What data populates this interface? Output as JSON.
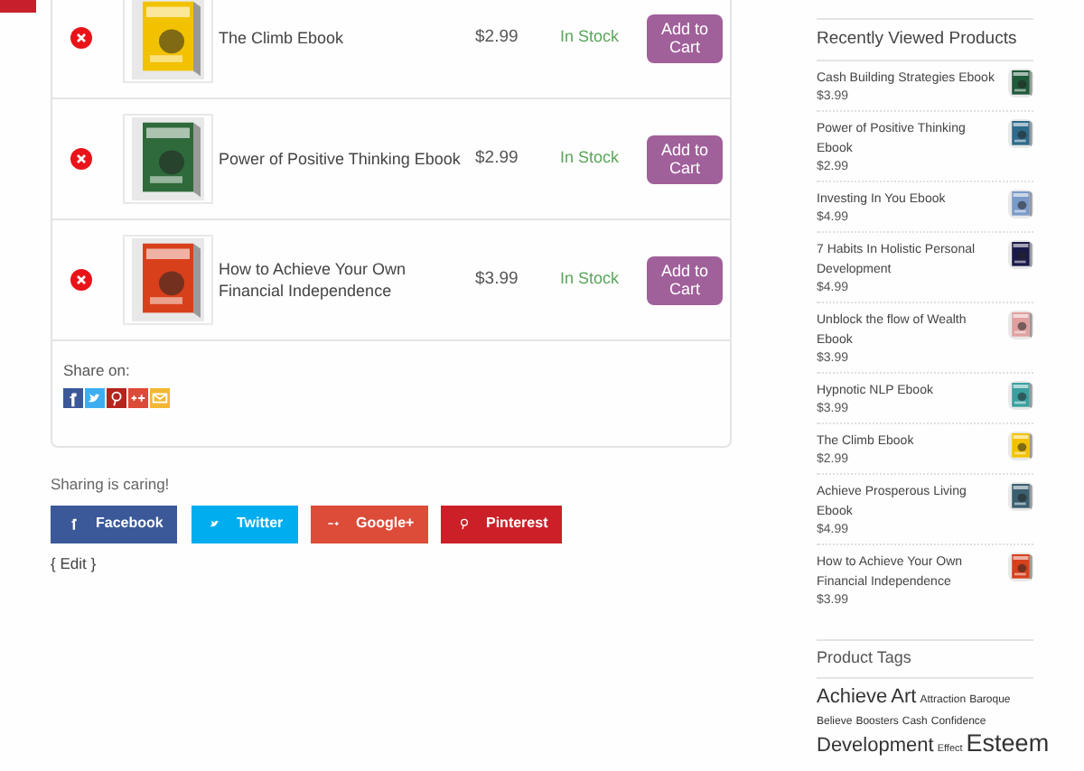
{
  "wishlist": {
    "rows": [
      {
        "name": "The Climb Ebook",
        "price": "$2.99",
        "stock": "In Stock",
        "button": "Add to Cart",
        "color": "#f2c200"
      },
      {
        "name": "Power of Positive Thinking Ebook",
        "price": "$2.99",
        "stock": "In Stock",
        "button": "Add to Cart",
        "color": "#2e6a3a"
      },
      {
        "name": "How to Achieve Your Own Financial Independence",
        "price": "$3.99",
        "stock": "In Stock",
        "button": "Add to Cart",
        "color": "#d8401c"
      }
    ],
    "share": {
      "label": "Share on:",
      "icons": [
        {
          "kind": "facebook"
        },
        {
          "kind": "twitter"
        },
        {
          "kind": "pinterest"
        },
        {
          "kind": "googleplus"
        },
        {
          "kind": "email"
        }
      ]
    }
  },
  "sharing": {
    "label": "Sharing is caring!",
    "buttons": [
      {
        "kind": "facebook",
        "label": "Facebook"
      },
      {
        "kind": "twitter",
        "label": "Twitter"
      },
      {
        "kind": "googleplus",
        "label": "Google+"
      },
      {
        "kind": "pinterest",
        "label": "Pinterest"
      }
    ]
  },
  "edit_link": "{ Edit }",
  "sidebar": {
    "recent": {
      "title": "Recently Viewed Products",
      "items": [
        {
          "name": "Cash Building Strategies Ebook",
          "price": "$3.99",
          "color": "#1f5a3a"
        },
        {
          "name": "Power of Positive Thinking Ebook",
          "price": "$2.99",
          "color": "#2e6a8a"
        },
        {
          "name": "Investing In You Ebook",
          "price": "$4.99",
          "color": "#7a9ac8"
        },
        {
          "name": "7 Habits In Holistic Personal Development",
          "price": "$4.99",
          "color": "#1a1a4a"
        },
        {
          "name": "Unblock the flow of Wealth Ebook",
          "price": "$3.99",
          "color": "#e0a0a0"
        },
        {
          "name": "Hypnotic NLP Ebook",
          "price": "$3.99",
          "color": "#3aa0a0"
        },
        {
          "name": "The Climb Ebook",
          "price": "$2.99",
          "color": "#f2c200"
        },
        {
          "name": "Achieve Prosperous Living Ebook",
          "price": "$4.99",
          "color": "#3a6070"
        },
        {
          "name": "How to Achieve Your Own Financial Independence",
          "price": "$3.99",
          "color": "#d8401c"
        }
      ]
    },
    "tags": {
      "title": "Product Tags",
      "lines": [
        [
          {
            "label": "Achieve",
            "kind": "large"
          },
          {
            "label": "Art",
            "kind": "large"
          },
          {
            "label": "Attraction",
            "kind": "small"
          },
          {
            "label": "Baroque",
            "kind": "small"
          }
        ],
        [
          {
            "label": "Believe",
            "kind": "small"
          },
          {
            "label": "Boosters",
            "kind": "small"
          },
          {
            "label": "Cash",
            "kind": "small"
          },
          {
            "label": "Confidence",
            "kind": "small"
          }
        ],
        [
          {
            "label": "Development",
            "kind": "large"
          },
          {
            "label": "Effect",
            "kind": "tiny"
          },
          {
            "label": "Esteem",
            "kind": "huge"
          }
        ]
      ]
    }
  }
}
